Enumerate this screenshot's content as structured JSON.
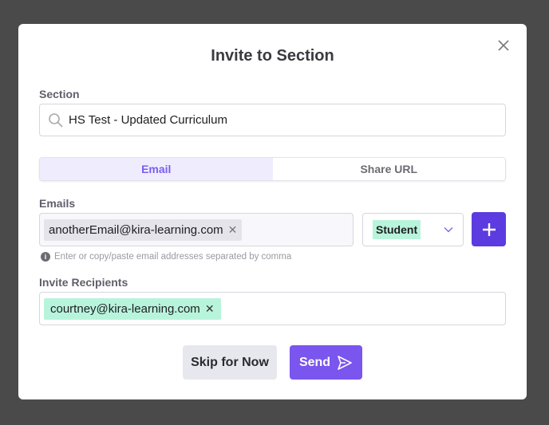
{
  "modal": {
    "title": "Invite to Section",
    "close_icon": "close-icon"
  },
  "section": {
    "label": "Section",
    "value": "HS Test - Updated Curriculum",
    "icon": "search-icon"
  },
  "tabs": [
    {
      "label": "Email",
      "active": true
    },
    {
      "label": "Share URL",
      "active": false
    }
  ],
  "emails": {
    "label": "Emails",
    "chips": [
      "anotherEmail@kira-learning.com"
    ],
    "role": "Student",
    "hint": "Enter or copy/paste email addresses separated by comma"
  },
  "recipients": {
    "label": "Invite Recipients",
    "chips": [
      "courtney@kira-learning.com"
    ]
  },
  "buttons": {
    "skip": "Skip for Now",
    "send": "Send"
  },
  "colors": {
    "accent": "#5c3be0",
    "send": "#7a55ee",
    "tag_green": "#b8f4dc",
    "chip_gray": "#e4e4ea"
  }
}
